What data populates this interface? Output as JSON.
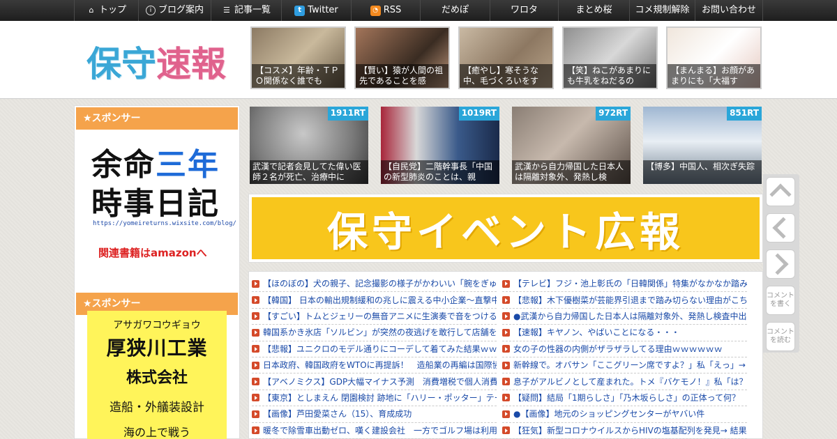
{
  "nav": {
    "items": [
      {
        "label": "トップ",
        "icon": "home-icon"
      },
      {
        "label": "ブログ案内",
        "icon": "info-icon"
      },
      {
        "label": "記事一覧",
        "icon": "list-icon"
      },
      {
        "label": "Twitter",
        "icon": "twitter-icon"
      },
      {
        "label": "RSS",
        "icon": "rss-icon"
      },
      {
        "label": "だめぽ"
      },
      {
        "label": "ワロタ"
      },
      {
        "label": "まとめ桜"
      },
      {
        "label": "コメ規制解除"
      },
      {
        "label": "お問い合わせ"
      }
    ]
  },
  "header": {
    "logo": "保守速報",
    "thumbs": [
      {
        "caption": "【コスメ】年齢・ＴＰＯ関係なく誰でも"
      },
      {
        "caption": "【賢い】猿が人間の祖先であることを感"
      },
      {
        "caption": "【癒やし】寒そうな中、毛づくろいをす"
      },
      {
        "caption": "【笑】ねこがあまりにも牛乳をねだるの"
      },
      {
        "caption": "【まんまる】お顔があまりにも「大福す"
      }
    ]
  },
  "sidebar": {
    "sponsor_label_1": "★スポンサー",
    "ad1": {
      "line1a": "余命",
      "line1b": "三年",
      "line2": "時事日記",
      "url": "https://yomeireturns.wixsite.com/blog/",
      "amazon": "関連書籍はamazonへ"
    },
    "sponsor_label_2": "★スポンサー",
    "ad2": {
      "kana": "アサガワコウギョウ",
      "name": "厚狭川工業",
      "corp": "株式会社",
      "biz": "造船・外艤装設計",
      "bottom": "海の上で戦う"
    }
  },
  "features": [
    {
      "rt": "1911RT",
      "caption": "武漢で記者会見してた偉い医師２名が死亡、治療中に"
    },
    {
      "rt": "1019RT",
      "caption": "【自民党】二階幹事長「中国の新型肺炎のことは、親"
    },
    {
      "rt": "972RT",
      "caption": "武漢から自力帰国した日本人は隔離対象外、発熱し検"
    },
    {
      "rt": "851RT",
      "caption": "【博多】中国人、相次ぎ失踪"
    }
  ],
  "banner": {
    "text": "保守イベント広報"
  },
  "headlines": {
    "left": [
      "【ほのぼの】犬の親子、記念撮影の様子がかわいい「腕をぎゅ",
      "【韓国】 日本の輸出規制緩和の兆しに震える中小企業～直撃中",
      "【すごい】トムとジェリーの無音アニメに生演奏で音をつける",
      "韓国系かき氷店「ソルビン」が突然の夜逃げを敢行して店舗を",
      "【悲報】ユニクロのモデル通りにコーデして着てみた結果ｗｗ",
      "日本政府、韓国政府をWTOに再提訴！　造船業の再編は国際協",
      "【アベノミクス】GDP大幅マイナス予測　消費増税で個人消費",
      "【東京】としまえん 閉園検討 跡地に「ハリー・ポッター」テー",
      "【画像】芦田愛菜さん（15）、育成成功",
      "暖冬で除雪車出動ゼロ、嘆く建設会社　一方でゴルフ場は利用"
    ],
    "right": [
      "【テレビ】フジ・池上彰氏の「日韓関係」特集がなかなか踏み",
      "【悲報】木下優樹菜が芸能界引退まで踏み切らない理由がこち",
      "●武漢から自力帰国した日本人は隔離対象外、発熱し検査中出",
      "【速報】キヤノン、やばいことになる・・・",
      "女の子の性器の内側がザラザラしてる理由ｗｗｗｗｗｗ",
      "新幹線で。オバサン「ここグリーン席ですよ？」私「えっ」→",
      "息子がアルビノとして産まれた。トメ『バケモノ！』私「は？",
      "【疑問】結局「1期らしさ」「乃木坂らしさ」の正体って何？",
      "●【画像】地元のショッピングセンターがヤバい件",
      "【狂気】新型コロナウイルスからHIVの塩基配列を発見→ 結果"
    ]
  },
  "floatbar": {
    "comment_write": "コメントを書く",
    "comment_read": "コメントを読む"
  }
}
